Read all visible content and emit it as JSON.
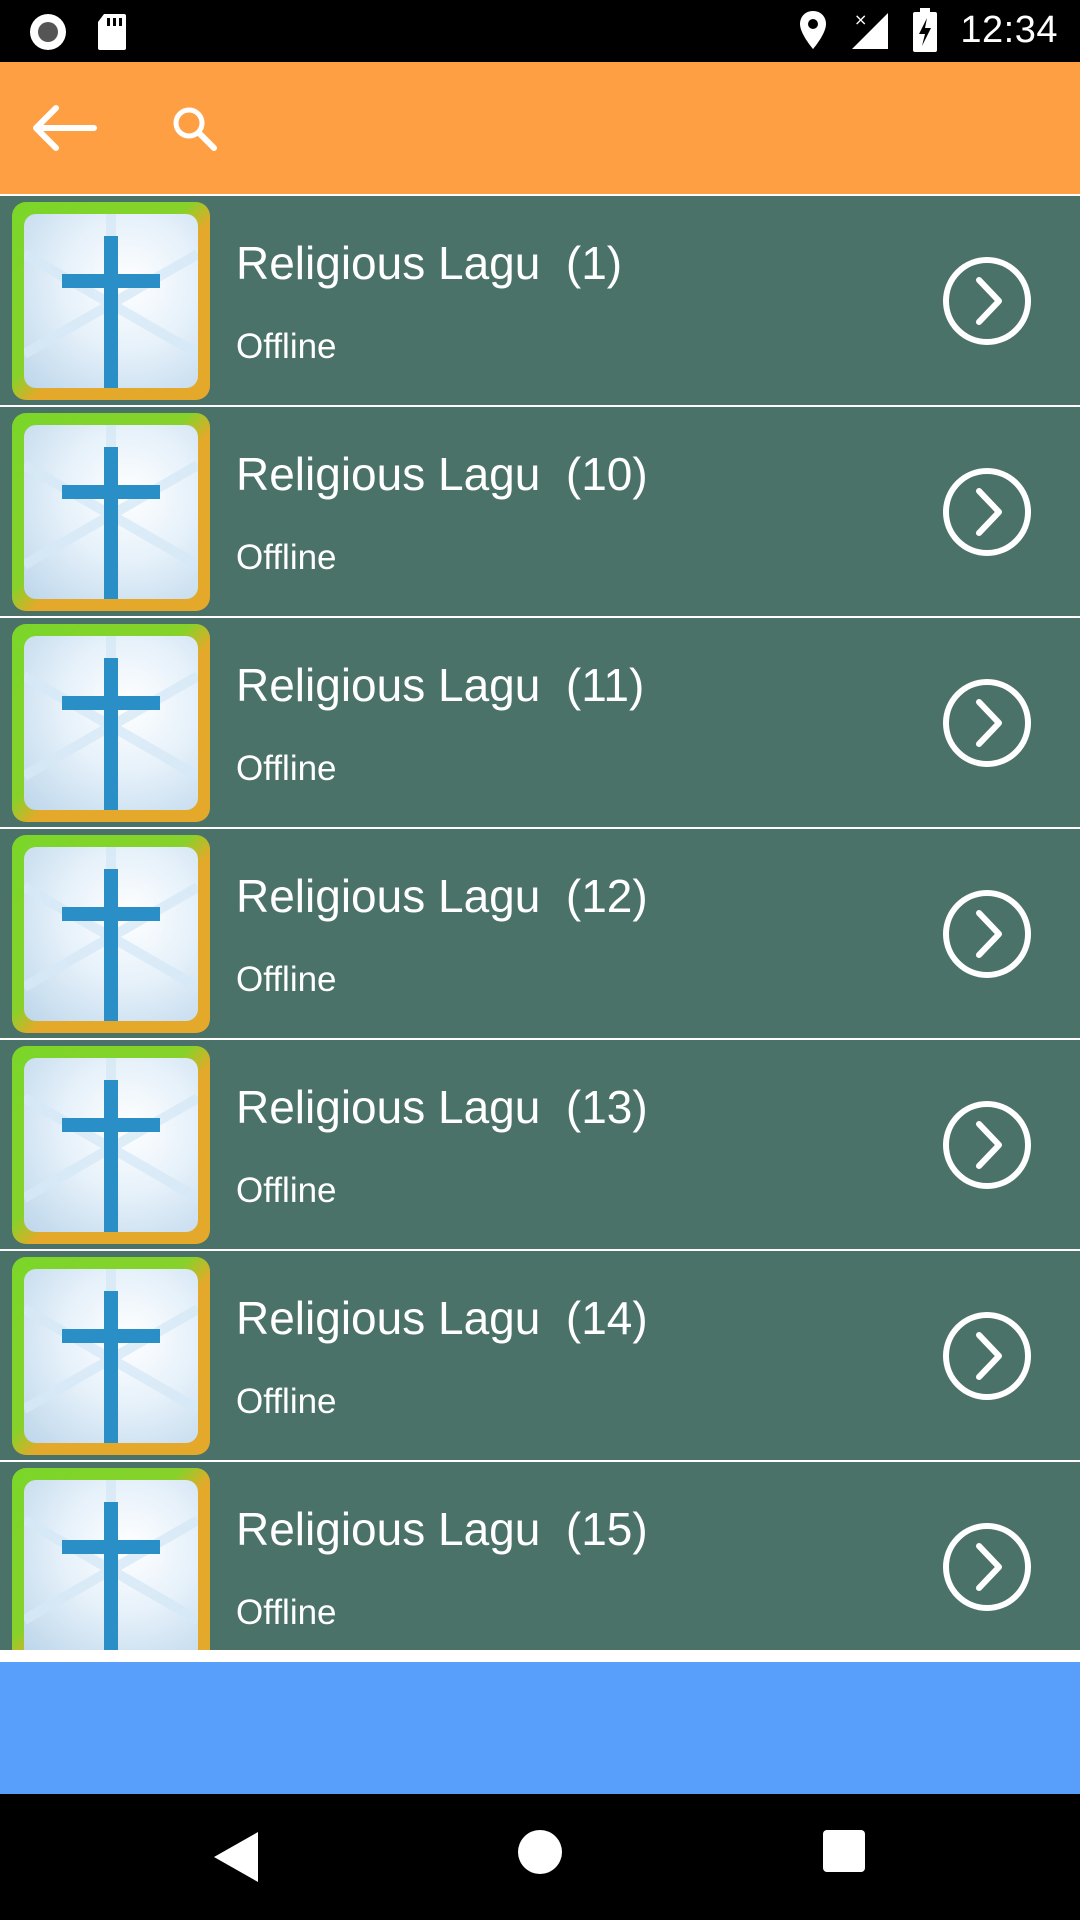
{
  "status_bar": {
    "time": "12:34",
    "icons": [
      "circle-record-icon",
      "sd-card-icon",
      "location-icon",
      "signal-icon",
      "battery-charging-icon"
    ]
  },
  "app_bar": {
    "icons": [
      "back-arrow-icon",
      "search-icon"
    ],
    "background": "#ff9f43"
  },
  "list": {
    "item_background": "#4b7268",
    "items": [
      {
        "title": "Religious Lagu  (1)",
        "subtitle": "Offline"
      },
      {
        "title": "Religious Lagu  (10)",
        "subtitle": "Offline"
      },
      {
        "title": "Religious Lagu  (11)",
        "subtitle": "Offline"
      },
      {
        "title": "Religious Lagu  (12)",
        "subtitle": "Offline"
      },
      {
        "title": "Religious Lagu  (13)",
        "subtitle": "Offline"
      },
      {
        "title": "Religious Lagu  (14)",
        "subtitle": "Offline"
      },
      {
        "title": "Religious Lagu  (15)",
        "subtitle": "Offline"
      }
    ]
  },
  "ad_banner": {
    "background": "#579ffb"
  },
  "nav_bar": {
    "icons": [
      "nav-back-icon",
      "nav-home-icon",
      "nav-recent-icon"
    ]
  }
}
